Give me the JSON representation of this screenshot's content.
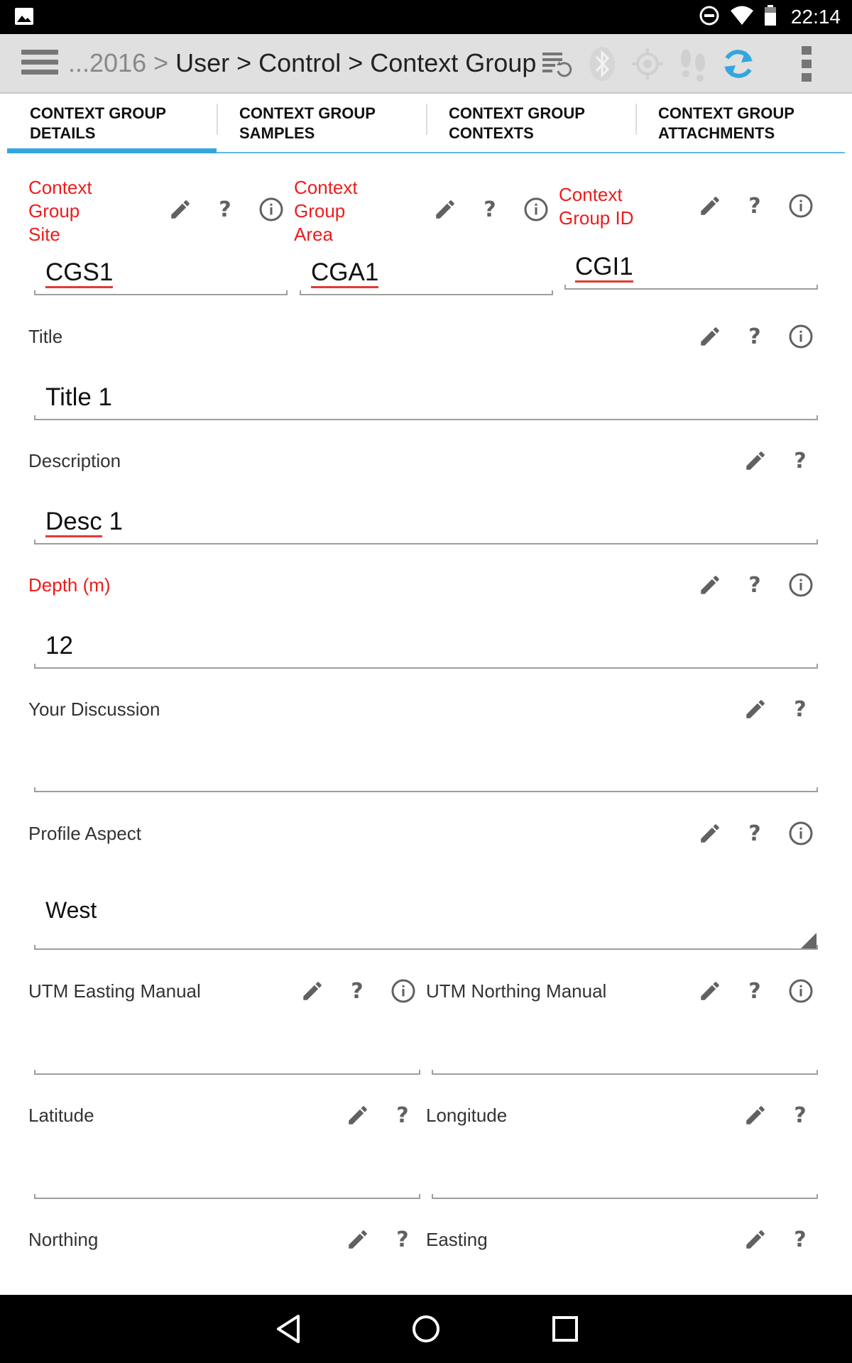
{
  "status_bar": {
    "time": "22:14",
    "icons": [
      "image-icon",
      "do-not-disturb-icon",
      "wifi-icon",
      "battery-icon"
    ]
  },
  "toolbar": {
    "breadcrumb_dim": "...2016 > ",
    "breadcrumb": "User > Control > Context Group",
    "icons": [
      "sync-list-icon",
      "bluetooth-icon",
      "gps-icon",
      "footsteps-icon",
      "refresh-icon",
      "overflow-menu-icon"
    ],
    "accent": "#33a6dd"
  },
  "tabs": [
    {
      "label": "CONTEXT GROUP\nDETAILS",
      "active": true
    },
    {
      "label": "CONTEXT GROUP\nSAMPLES",
      "active": false
    },
    {
      "label": "CONTEXT GROUP\nCONTEXTS",
      "active": false
    },
    {
      "label": "CONTEXT GROUP\nATTACHMENTS",
      "active": false
    }
  ],
  "fields": {
    "site": {
      "label_lines": [
        "Context",
        "Group",
        "Site"
      ],
      "value": "CGS1",
      "required": true
    },
    "area": {
      "label_lines": [
        "Context",
        "Group",
        "Area"
      ],
      "value": "CGA1",
      "required": true
    },
    "id": {
      "label_lines": [
        "Context",
        "Group ID"
      ],
      "value": "CGI1",
      "required": true
    },
    "title": {
      "label": "Title",
      "value": "Title 1"
    },
    "description": {
      "label": "Description",
      "value_word": "Desc",
      "value_rest": " 1"
    },
    "depth": {
      "label": "Depth (m)",
      "value": "12",
      "required": true
    },
    "discussion": {
      "label": "Your Discussion",
      "value": ""
    },
    "profile_aspect": {
      "label": "Profile Aspect",
      "value": "West"
    },
    "utm_easting": {
      "label": "UTM Easting Manual",
      "value": ""
    },
    "utm_northing": {
      "label": "UTM Northing Manual",
      "value": ""
    },
    "latitude": {
      "label": "Latitude",
      "value": ""
    },
    "longitude": {
      "label": "Longitude",
      "value": ""
    },
    "northing": {
      "label": "Northing",
      "value": ""
    },
    "easting": {
      "label": "Easting",
      "value": ""
    }
  },
  "colors": {
    "required_label": "#ee1c1c",
    "spellcheck": "#e53935",
    "icon": "#616161"
  },
  "help_glyph": "?"
}
